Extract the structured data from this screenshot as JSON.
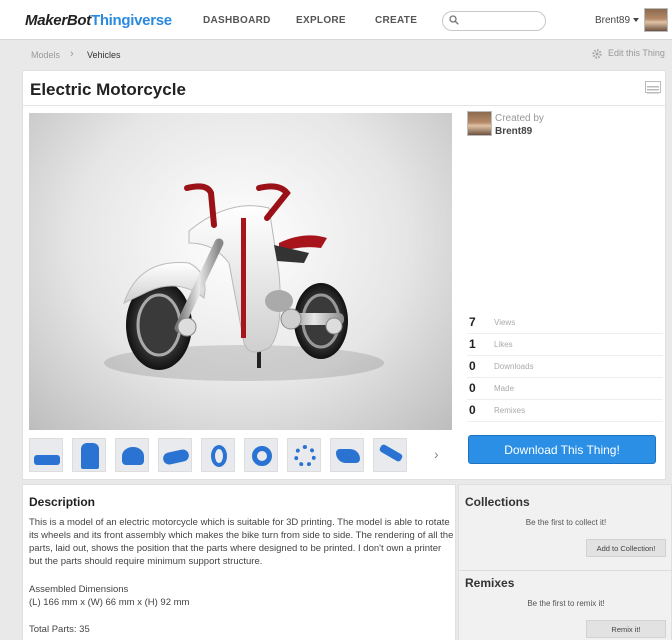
{
  "header": {
    "logo_part1": "MakerBot",
    "logo_part2": "Thingiverse",
    "nav": [
      "DASHBOARD",
      "EXPLORE",
      "CREATE"
    ],
    "search_placeholder": "",
    "user": "Brent89",
    "icons": [
      "search-icon",
      "caret-down-icon",
      "user-avatar"
    ]
  },
  "breadcrumb": {
    "items": [
      "Models",
      "Vehicles"
    ],
    "edit_label": "Edit this Thing"
  },
  "thing": {
    "title": "Electric Motorcycle",
    "created_by_label": "Created by",
    "creator": "Brent89",
    "stats": [
      {
        "value": "7",
        "label": "Views"
      },
      {
        "value": "1",
        "label": "Likes"
      },
      {
        "value": "0",
        "label": "Downloads"
      },
      {
        "value": "0",
        "label": "Made"
      },
      {
        "value": "0",
        "label": "Remixes"
      }
    ],
    "download_label": "Download This Thing!",
    "thumbnail_count": 9
  },
  "description": {
    "heading": "Description",
    "body": "This is a model of an electric motorcycle which is suitable for 3D printing. The model is able to rotate its wheels and its front assembly which makes the bike turn from side to side. The rendering of all the parts, laid out, shows the position that the parts where designed to be printed. I don't own a printer but the parts should require minimum support structure.",
    "dims_heading": "Assembled Dimensions",
    "dims_value": "(L) 166 mm x (W) 66 mm x (H) 92 mm",
    "total_parts": "Total Parts: 35"
  },
  "sidebar": {
    "collections_heading": "Collections",
    "collections_note": "Be the first to collect it!",
    "collections_button": "Add to Collection!",
    "remixes_heading": "Remixes",
    "remixes_note": "Be the first to remix it!",
    "remix_button": "Remix it!"
  },
  "colors": {
    "accent": "#2b8fe6",
    "logo_blue": "#2a8ae0",
    "part_blue": "#2a73d2",
    "bike_red": "#a8141c"
  }
}
